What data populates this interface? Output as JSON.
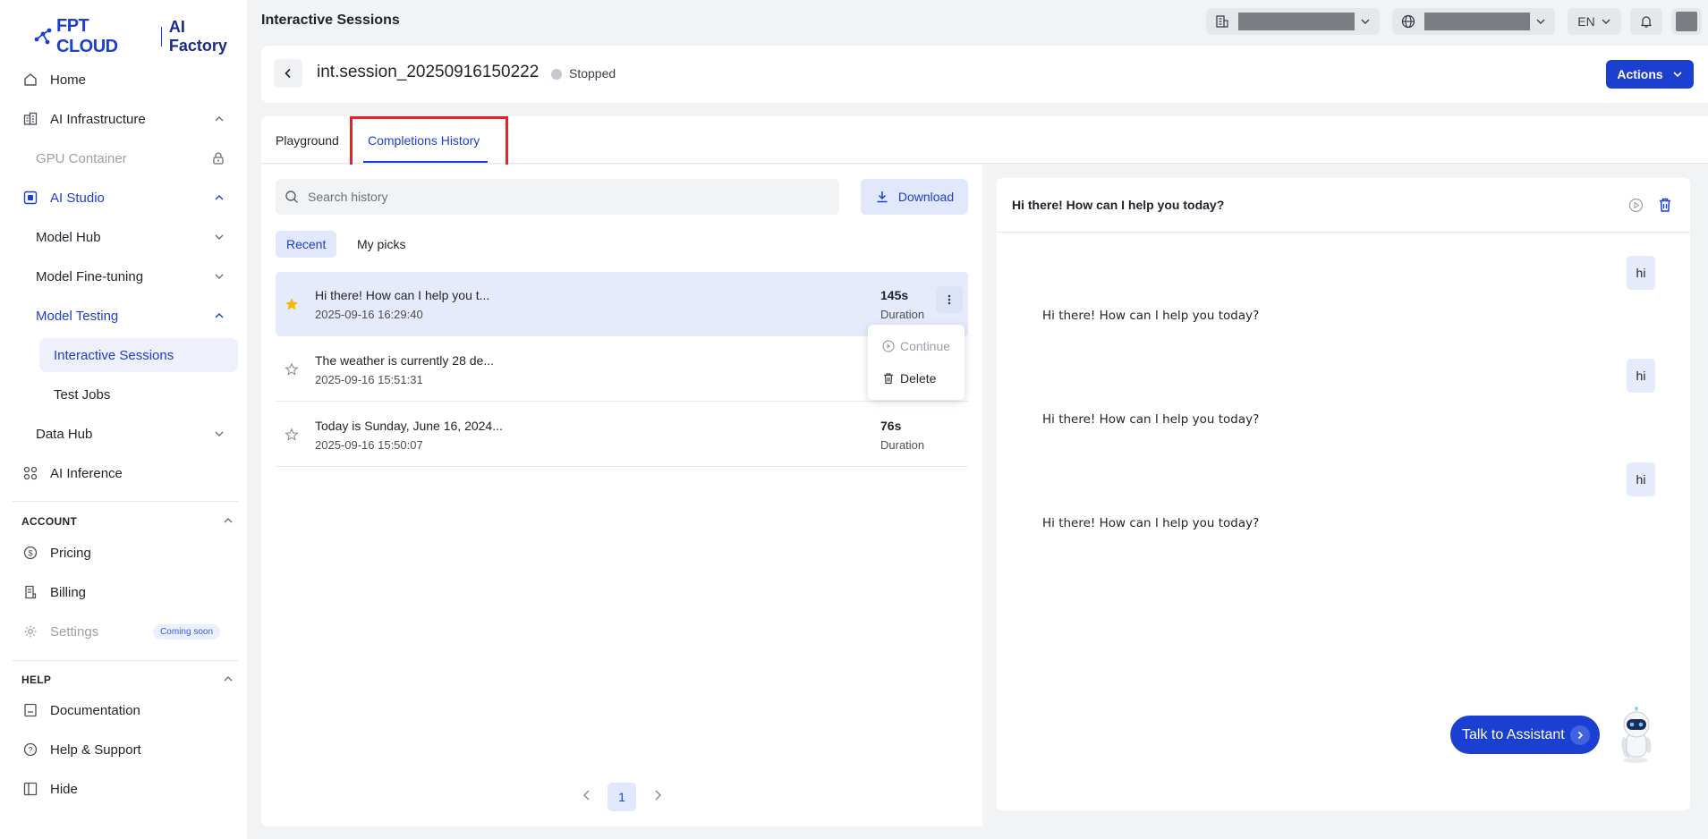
{
  "brand": {
    "logo_main": "FPT CLOUD",
    "logo_sub": "AI Factory"
  },
  "sidebar": {
    "home": "Home",
    "ai_infrastructure": "AI Infrastructure",
    "gpu_container": "GPU Container",
    "ai_studio": "AI Studio",
    "model_hub": "Model Hub",
    "model_finetuning": "Model Fine-tuning",
    "model_testing": "Model Testing",
    "interactive_sessions": "Interactive Sessions",
    "test_jobs": "Test Jobs",
    "data_hub": "Data Hub",
    "ai_inference": "AI Inference",
    "account_header": "ACCOUNT",
    "pricing": "Pricing",
    "billing": "Billing",
    "settings": "Settings",
    "coming_soon": "Coming soon",
    "help_header": "HELP",
    "documentation": "Documentation",
    "help_support": "Help & Support",
    "hide": "Hide"
  },
  "topbar": {
    "title": "Interactive Sessions",
    "language": "EN"
  },
  "header": {
    "session_name": "int.session_20250916150222",
    "status": "Stopped",
    "actions_label": "Actions"
  },
  "tabs": {
    "playground": "Playground",
    "completions_history": "Completions History"
  },
  "history": {
    "search_placeholder": "Search history",
    "download_label": "Download",
    "filter_recent": "Recent",
    "filter_mypicks": "My picks",
    "items": [
      {
        "title": "Hi there! How can I help you t...",
        "date": "2025-09-16 16:29:40",
        "duration": "145s",
        "duration_label": "Duration",
        "starred": true
      },
      {
        "title": "The weather is currently 28 de...",
        "date": "2025-09-16 15:51:31",
        "duration": "",
        "duration_label": "",
        "starred": false
      },
      {
        "title": "Today is Sunday, June 16, 2024...",
        "date": "2025-09-16 15:50:07",
        "duration": "76s",
        "duration_label": "Duration",
        "starred": false
      }
    ],
    "context_menu": {
      "continue": "Continue",
      "delete": "Delete"
    },
    "page": "1"
  },
  "detail": {
    "title": "Hi there! How can I help you today?",
    "messages": [
      {
        "user": "hi",
        "assistant": "Hi there! How can I help you today?"
      },
      {
        "user": "hi",
        "assistant": "Hi there! How can I help you today?"
      },
      {
        "user": "hi",
        "assistant": "Hi there! How can I help you today?"
      }
    ]
  },
  "assistant": {
    "label": "Talk to Assistant"
  },
  "colors": {
    "primary": "#1a3fd1",
    "highlight": "#e02626",
    "star": "#f5b800"
  }
}
